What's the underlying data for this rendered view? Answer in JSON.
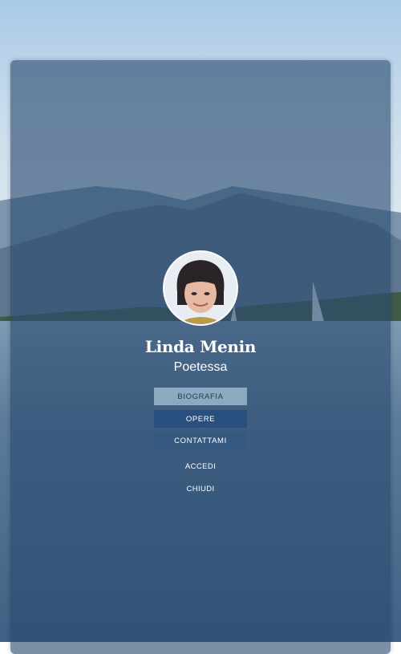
{
  "profile": {
    "name": "Linda Menin",
    "role": "Poetessa"
  },
  "menu": {
    "items": [
      {
        "label": "BIOGRAFIA"
      },
      {
        "label": "OPERE"
      },
      {
        "label": "CONTATTAMI"
      }
    ]
  },
  "actions": {
    "login_label": "ACCEDI",
    "close_label": "CHIUDI"
  },
  "colors": {
    "panel_overlay": "#2a4a70",
    "button_active": "#8ba9bf",
    "button_default": "#284f7d",
    "text": "#ffffff"
  },
  "icons": {
    "avatar": "profile-photo"
  }
}
